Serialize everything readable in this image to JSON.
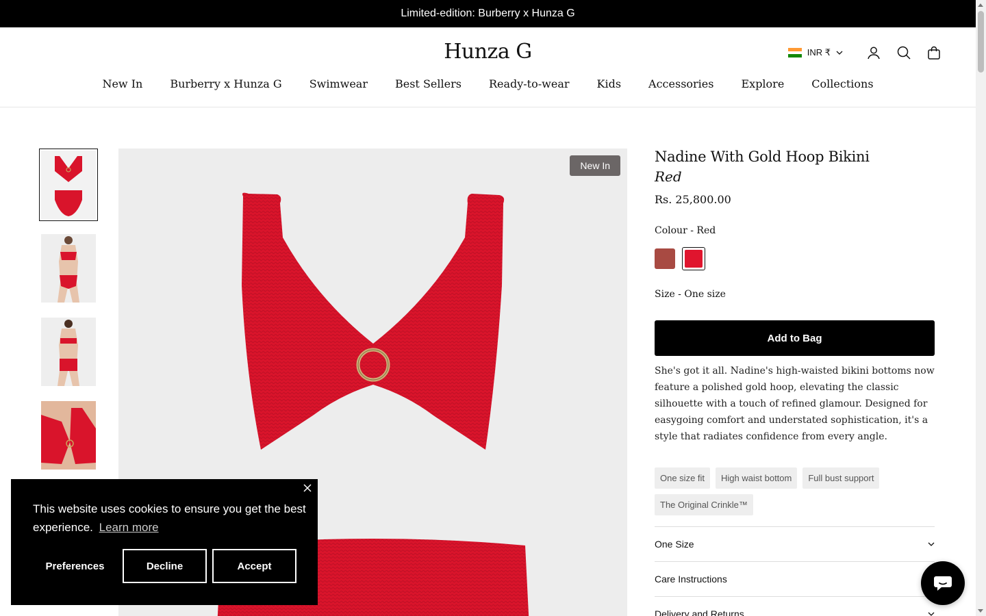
{
  "announcement": "Limited-edition: Burberry x Hunza G",
  "header": {
    "logo": "Hunza G",
    "currency": "INR ₹",
    "icons": [
      "account-icon",
      "search-icon",
      "bag-icon"
    ]
  },
  "nav": [
    "New In",
    "Burberry x Hunza G",
    "Swimwear",
    "Best Sellers",
    "Ready-to-wear",
    "Kids",
    "Accessories",
    "Explore",
    "Collections"
  ],
  "gallery": {
    "badge": "New In",
    "thumbnails": [
      "thumb-product-flatlay",
      "thumb-model-front",
      "thumb-model-back",
      "thumb-model-closeup",
      "thumb-model-5"
    ]
  },
  "product": {
    "title": "Nadine With Gold Hoop Bikini",
    "subtitle": "Red",
    "price": "Rs. 25,800.00",
    "colour_label": "Colour",
    "colour_value": "- Red",
    "swatches": [
      "#a84a42",
      "#e0152e"
    ],
    "size_label": "Size - One size",
    "add_to_bag": "Add to Bag",
    "description": "She's got it all. Nadine's high-waisted bikini bottoms now feature a polished gold hoop, elevating the classic silhouette with a touch of refined glamour. Designed for easygoing comfort and understated sophistication, it's a style that radiates confidence from every angle.",
    "tags": [
      "One size fit",
      "High waist bottom",
      "Full bust support",
      "The Original Crinkle™"
    ],
    "accordion": [
      "One Size",
      "Care Instructions",
      "Delivery and Returns"
    ]
  },
  "cookie": {
    "text": "This website uses cookies to ensure you get the best experience.",
    "learn_more": "Learn more",
    "preferences": "Preferences",
    "decline": "Decline",
    "accept": "Accept"
  },
  "colors": {
    "accent": "#000000",
    "product_red": "#d9142b"
  }
}
